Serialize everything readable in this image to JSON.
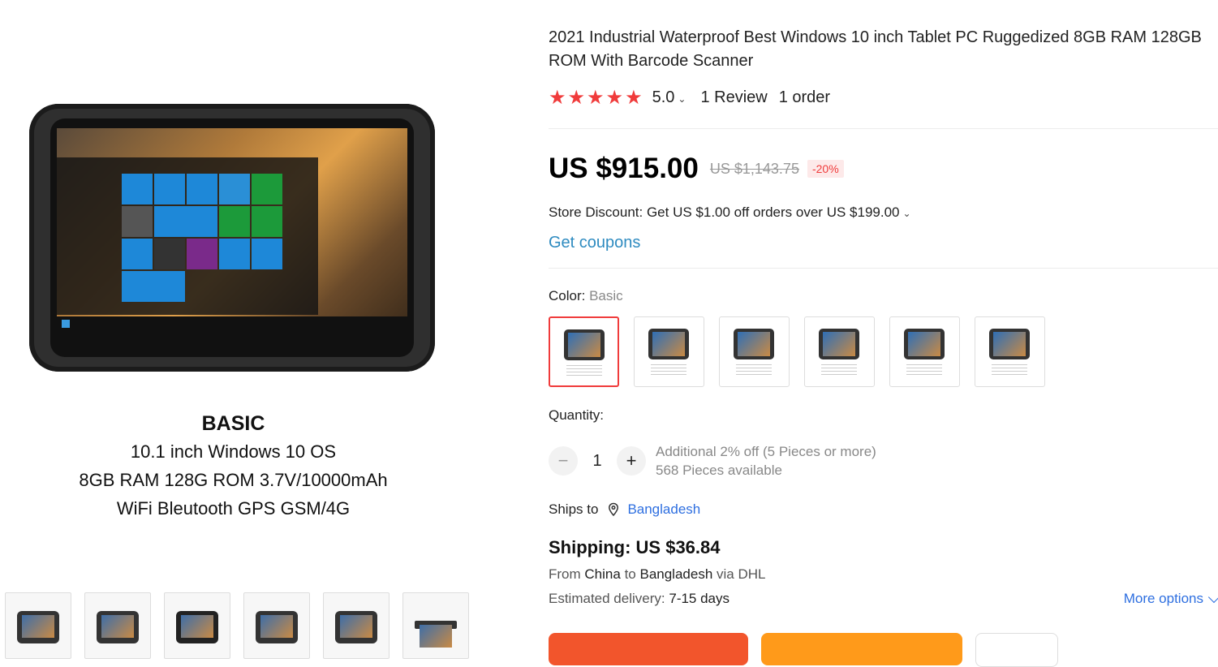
{
  "product": {
    "title": "2021 Industrial Waterproof Best Windows 10 inch Tablet PC Ruggedized 8GB RAM 128GB ROM With Barcode Scanner",
    "rating": "5.0",
    "reviews": "1 Review",
    "orders": "1 order"
  },
  "image_specs": {
    "heading": "BASIC",
    "line1": "10.1 inch Windows 10 OS",
    "line2": "8GB RAM 128G ROM 3.7V/10000mAh",
    "line3": "WiFi Bleutooth GPS GSM/4G"
  },
  "pricing": {
    "price": "US $915.00",
    "original_price": "US $1,143.75",
    "discount": "-20%",
    "store_discount": "Store Discount: Get US $1.00 off orders over US $199.00",
    "coupons_link": "Get coupons"
  },
  "color": {
    "label": "Color:",
    "selected": "Basic",
    "options_count": 6
  },
  "quantity": {
    "label": "Quantity:",
    "value": "1",
    "minus": "−",
    "plus": "+",
    "bulk_offer": "Additional 2% off (5 Pieces or more)",
    "available": "568 Pieces available"
  },
  "shipping": {
    "ships_to_label": "Ships to",
    "country": "Bangladesh",
    "cost": "Shipping: US $36.84",
    "from_label": "From",
    "from": "China",
    "to_label": "to",
    "to": "Bangladesh",
    "via": "via DHL",
    "estimated_label": "Estimated delivery:",
    "estimated": "7-15 days",
    "more_options": "More options"
  },
  "colors": {
    "accent_red": "#f03b3b",
    "link_blue": "#2e6fe0",
    "coupon_blue": "#2e8bc0",
    "buy_orange": "#f2552c",
    "cart_orange": "#ff9a1a"
  }
}
